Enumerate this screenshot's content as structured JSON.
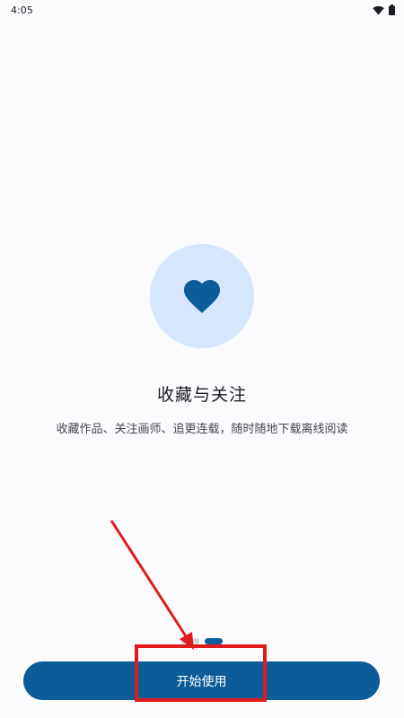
{
  "status_bar": {
    "time": "4:05",
    "icons": [
      "wifi-icon",
      "battery-icon"
    ]
  },
  "onboarding": {
    "icon": "heart-icon",
    "title": "收藏与关注",
    "description": "收藏作品、关注画师、追更连载，随时随地下载离线阅读",
    "page_count": 3,
    "current_page": 3
  },
  "actions": {
    "start_label": "开始使用"
  },
  "colors": {
    "primary": "#0b5c99",
    "icon_bg": "#d6e6fc",
    "background": "#fbfbfe",
    "annotation": "#e01b1b"
  }
}
